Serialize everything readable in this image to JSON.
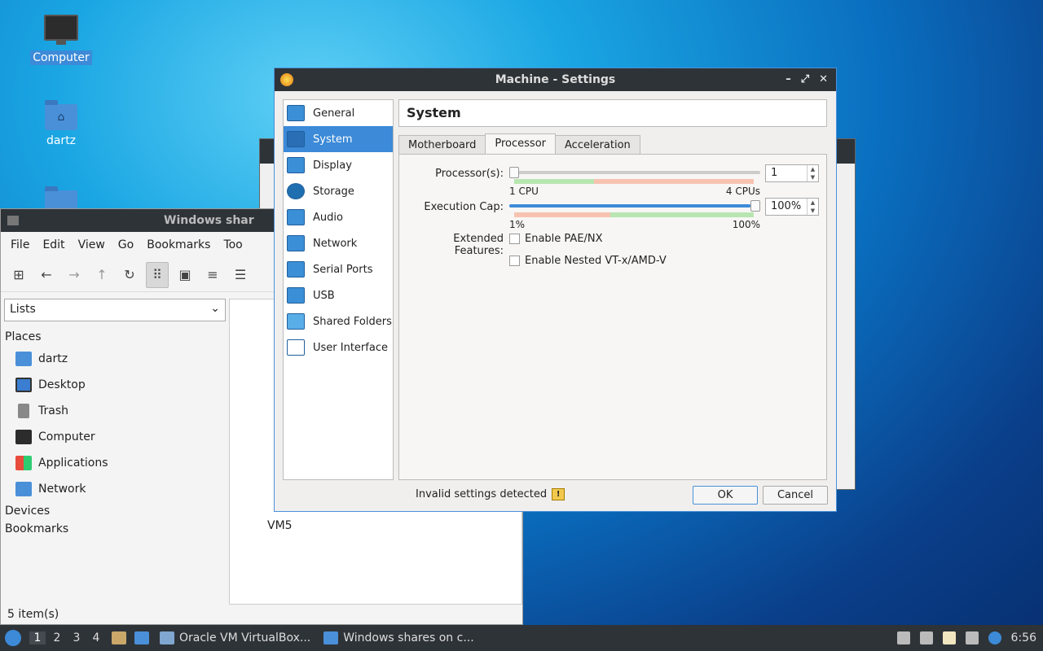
{
  "desktop": {
    "icons": [
      {
        "label": "Computer",
        "selected": true
      },
      {
        "label": "dartz"
      }
    ]
  },
  "file_manager": {
    "title": "Windows shar",
    "menu": [
      "File",
      "Edit",
      "View",
      "Go",
      "Bookmarks",
      "Too"
    ],
    "view_combo": "Lists",
    "places_header": "Places",
    "places": [
      "dartz",
      "Desktop",
      "Trash",
      "Computer",
      "Applications",
      "Network"
    ],
    "devices_header": "Devices",
    "bookmarks_header": "Bookmarks",
    "status": "5 item(s)",
    "file_label": "VM5"
  },
  "dialog": {
    "title": "Machine - Settings",
    "categories": [
      "General",
      "System",
      "Display",
      "Storage",
      "Audio",
      "Network",
      "Serial Ports",
      "USB",
      "Shared Folders",
      "User Interface"
    ],
    "selected_category": "System",
    "section_title": "System",
    "tabs": [
      "Motherboard",
      "Processor",
      "Acceleration"
    ],
    "active_tab": "Processor",
    "processors": {
      "label": "Processor(s):",
      "value": "1",
      "min_label": "1 CPU",
      "max_label": "4 CPUs",
      "level": 0.0
    },
    "exec_cap": {
      "label": "Execution Cap:",
      "value": "100%",
      "min_label": "1%",
      "max_label": "100%",
      "level": 1.0
    },
    "extended_label": "Extended Features:",
    "features": [
      {
        "label": "Enable PAE/NX",
        "checked": false
      },
      {
        "label": "Enable Nested VT-x/AMD-V",
        "checked": false
      }
    ],
    "warning": "Invalid settings detected",
    "ok": "OK",
    "cancel": "Cancel"
  },
  "taskbar": {
    "workspaces": [
      "1",
      "2",
      "3",
      "4"
    ],
    "tasks": [
      "Oracle VM VirtualBox...",
      "Windows shares on c..."
    ],
    "clock": "6:56"
  },
  "colors": {
    "accent": "#3c8ad8",
    "titlebar": "#2e3338"
  }
}
